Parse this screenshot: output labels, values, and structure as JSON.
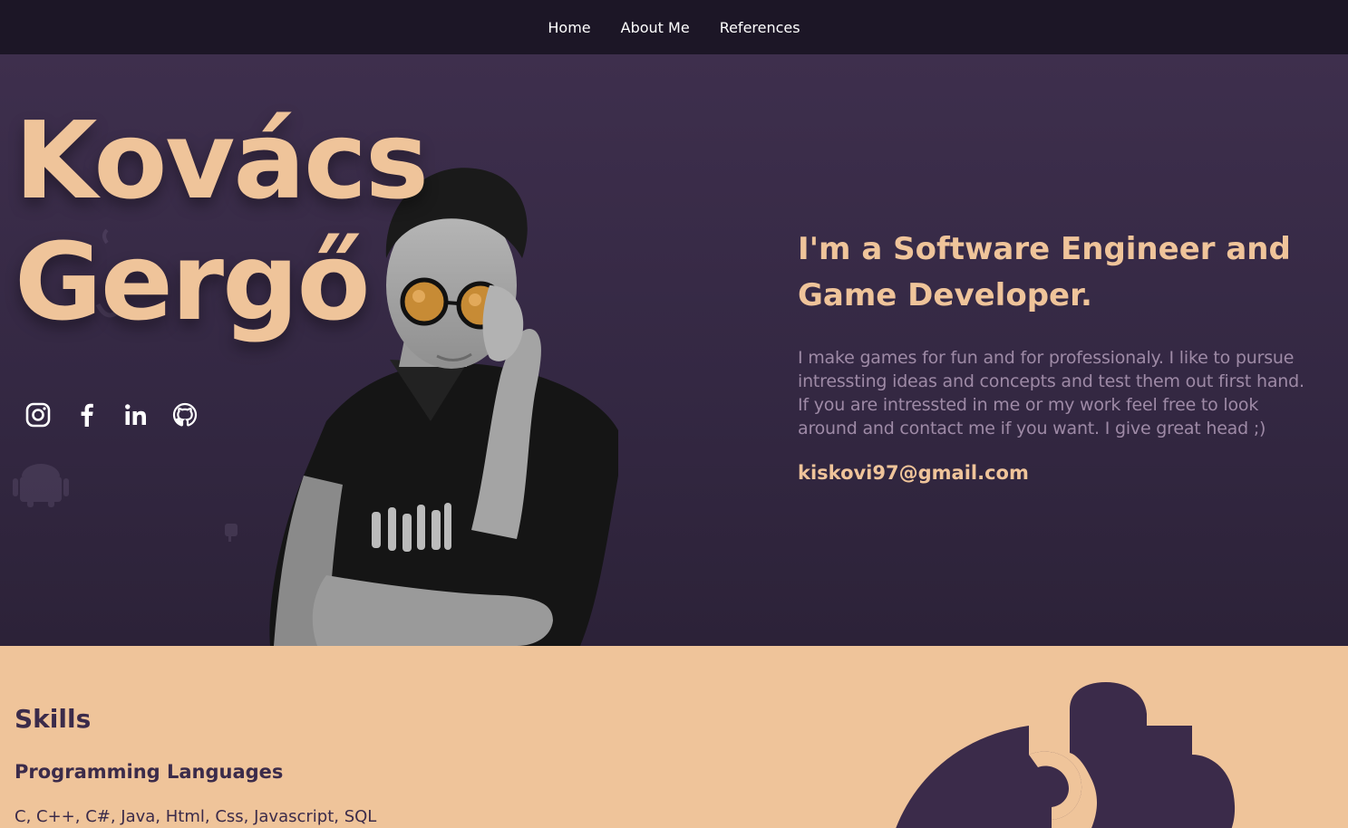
{
  "nav": {
    "items": [
      {
        "label": "Home"
      },
      {
        "label": "About Me"
      },
      {
        "label": "References"
      }
    ]
  },
  "hero": {
    "name_line1": "Kovács",
    "name_line2": "Gergő",
    "socials": [
      {
        "icon": "instagram-icon"
      },
      {
        "icon": "facebook-icon"
      },
      {
        "icon": "linkedin-icon"
      },
      {
        "icon": "github-icon"
      }
    ],
    "headline": "I'm a Software Engineer and Game Developer.",
    "description": "I make games for fun and for professionaly. I like to pursue intressting ideas and concepts and test them out first hand. If you are intressted in me or my work feel free to look around and contact me if you want. I give great head ;)",
    "email": "kiskovi97@gmail.com"
  },
  "skills": {
    "title": "Skills",
    "subtitle": "Programming Languages",
    "languages": "C, C++, C#, Java, Html, Css, Javascript, SQL"
  },
  "colors": {
    "accent": "#efc49a",
    "nav_bg": "#1c1626",
    "hero_bg": "#3d2e4a",
    "text_muted": "#9e8aa6",
    "dark_text": "#3b2b4a"
  }
}
